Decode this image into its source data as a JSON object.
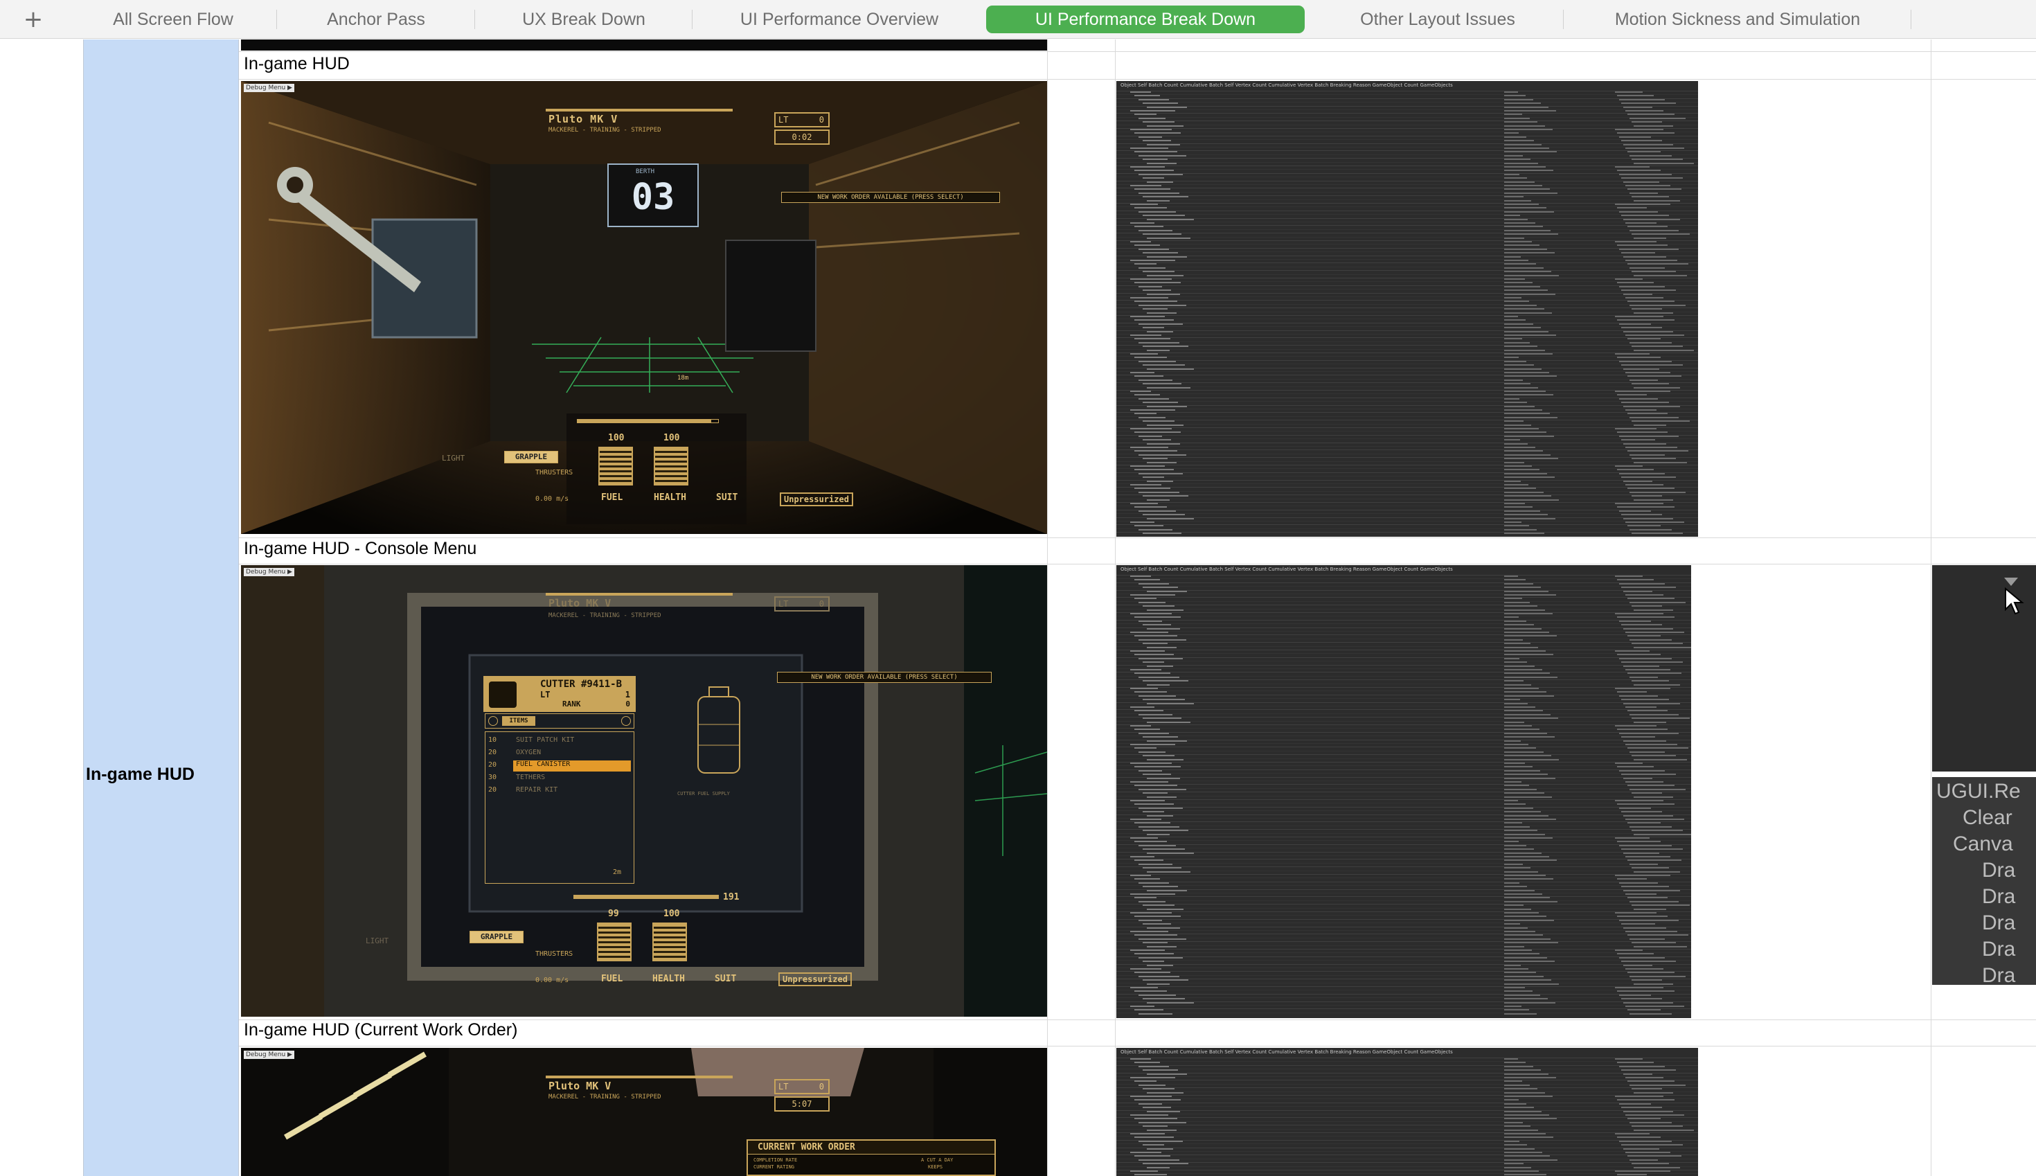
{
  "tabbar": {
    "add_label": "+",
    "tabs": [
      {
        "label": "All Screen Flow"
      },
      {
        "label": "Anchor Pass"
      },
      {
        "label": "UX Break Down"
      },
      {
        "label": "UI Performance Overview"
      },
      {
        "label": "UI Performance Break Down",
        "active": true
      },
      {
        "label": "Other Layout Issues"
      },
      {
        "label": "Motion Sickness and Simulation"
      }
    ]
  },
  "colors": {
    "active_tab": "#4caf50",
    "section_column": "#c6dbf6"
  },
  "section": {
    "label": "In-game HUD"
  },
  "rows": [
    {
      "title": "In-game HUD",
      "hud": {
        "debug": "Debug Menu ▶",
        "ship": "Pluto MK V",
        "subtitle": "MACKEREL - TRAINING - STRIPPED",
        "lt": "LT",
        "lt_val": "0",
        "timer": "0:02",
        "berth": "BERTH",
        "berth_num": "03",
        "notice": "NEW WORK ORDER AVAILABLE (PRESS SELECT)",
        "fuel_val": "100",
        "health_val": "100",
        "grapple": "GRAPPLE",
        "thrusters": "THRUSTERS",
        "fuel": "FUEL",
        "health": "HEALTH",
        "suit": "SUIT",
        "pressure": "Unpressurized",
        "speed": "0.00 m/s",
        "light": "LIGHT",
        "range": "18m"
      }
    },
    {
      "title": "In-game HUD - Console Menu",
      "hud": {
        "debug": "Debug Menu ▶",
        "ship": "Pluto MK V",
        "subtitle": "MACKEREL - TRAINING - STRIPPED",
        "lt": "LT",
        "lt_val": "0",
        "notice": "NEW WORK ORDER AVAILABLE (PRESS SELECT)",
        "cutter": "CUTTER #9411-B",
        "cutter_lt": "LT",
        "cutter_lt_val": "1",
        "rank": "RANK",
        "rank_val": "0",
        "items_tab": "ITEMS",
        "items": [
          {
            "qty": "10",
            "name": "SUIT PATCH KIT"
          },
          {
            "qty": "20",
            "name": "OXYGEN"
          },
          {
            "qty": "20",
            "name": "FUEL CANISTER"
          },
          {
            "qty": "30",
            "name": "TETHERS"
          },
          {
            "qty": "20",
            "name": "REPAIR KIT"
          }
        ],
        "supply": "CUTTER FUEL SUPPLY",
        "dist": "2m",
        "bar_val": "191",
        "fuel_val": "99",
        "health_val": "100",
        "grapple": "GRAPPLE",
        "thrusters": "THRUSTERS",
        "fuel": "FUEL",
        "health": "HEALTH",
        "suit": "SUIT",
        "pressure": "Unpressurized",
        "speed": "0.00 m/s",
        "light": "LIGHT"
      },
      "side": {
        "lines": [
          "UGUI.Re",
          "Clear",
          "Canva",
          "Dra",
          "Dra",
          "Dra",
          "Dra",
          "Dra"
        ]
      }
    },
    {
      "title": "In-game HUD (Current Work Order)",
      "hud": {
        "debug": "Debug Menu ▶",
        "ship": "Pluto MK V",
        "subtitle": "MACKEREL - TRAINING - STRIPPED",
        "lt": "LT",
        "lt_val": "0",
        "timer": "5:07",
        "work_order": "CURRENT WORK ORDER",
        "completion": "COMPLETION RATE",
        "rating": "CURRENT RATING",
        "cut": "A CUT A DAY",
        "keeps": "KEEPS"
      }
    }
  ],
  "profiler": {
    "headers": "Object          Self Batch Count   Cumulative Batch   Self Vertex Count   Cumulative Vertex   Batch Breaking Reason          GameObject Count   GameObjects"
  }
}
